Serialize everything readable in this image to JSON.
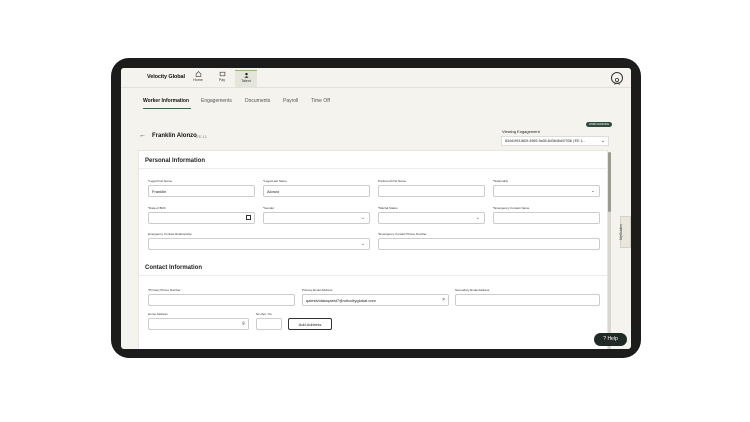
{
  "app": {
    "logo": "Velocity Global"
  },
  "nav": {
    "home": "Home",
    "pay": "Pay",
    "talent": "Talent"
  },
  "tabs": [
    "Worker Information",
    "Engagements",
    "Documents",
    "Payroll",
    "Time Off"
  ],
  "worker": {
    "name": "Franklin Alonzo",
    "id": "EE-11"
  },
  "badge": "ONBOARDING",
  "engagement": {
    "label": "Viewing Engagement",
    "value": "834d1f93-862f-4969-9a35-843645d47036 | EE 1..."
  },
  "personal": {
    "title": "Personal Information",
    "legal_first_label": "*Legal First Name",
    "legal_first_value": "Franklin",
    "legal_last_label": "*Legal Last Name",
    "legal_last_value": "Alonzo",
    "preferred_label": "Preferred First Name",
    "nationality_label": "*Nationality",
    "dob_label": "*Date of Birth",
    "gender_label": "*Gender",
    "marital_label": "*Marital Status",
    "emergency_name_label": "*Emergency Contact Name",
    "emergency_rel_label": "Emergency Contact Relationship",
    "emergency_phone_label": "*Emergency Contact Phone Number"
  },
  "contact": {
    "title": "Contact Information",
    "phone_label": "*Primary Phone Number",
    "email_label": "Primary Email Address",
    "email_value": "qalestvidaloqaest7@velocityglobal.com",
    "secondary_email_label": "Secondary Email Address",
    "home_address_label": "Home Address",
    "apt_label": "No./Apt. No.",
    "add_address": "Add Address"
  },
  "myguides": "MyGuides",
  "help": "Help"
}
